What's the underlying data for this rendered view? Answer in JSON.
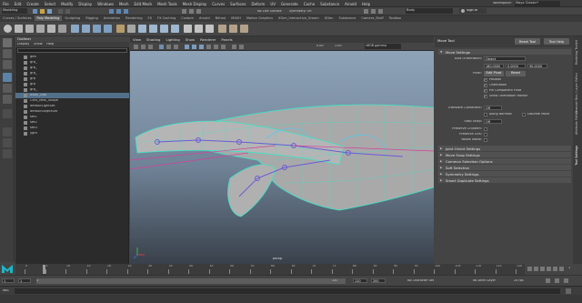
{
  "menubar": {
    "items": [
      "File",
      "Edit",
      "Create",
      "Select",
      "Modify",
      "Display",
      "Windows",
      "Mesh",
      "Edit Mesh",
      "Mesh Tools",
      "Mesh Display",
      "Curves",
      "Surfaces",
      "Deform",
      "UV",
      "Generate",
      "Cache",
      "Substance",
      "Arnold",
      "Help"
    ],
    "workspace_label": "Workspace:",
    "workspace_value": "Maya Classic*"
  },
  "status_line": {
    "mode_value": "Modeling",
    "no_live_surface": "No Live Surface",
    "symmetry_label": "Symmetry: Off",
    "search_value": "Body",
    "sign_in": "Sign In"
  },
  "shelf_tabs": [
    "Curves / Surfaces",
    "Poly Modeling",
    "Sculpting",
    "Rigging",
    "Animation",
    "Rendering",
    "FX",
    "FX Caching",
    "Custom",
    "Arnold",
    "Bifrost",
    "MASH",
    "Motion Graphics",
    "XGen_Interactive_Groom",
    "XGen",
    "Substance",
    "Camera_Stuff",
    "Toolbox"
  ],
  "shelf_active_tab": "Poly Modeling",
  "outliner": {
    "title": "Outliner",
    "menu": [
      "Display",
      "Show",
      "Help"
    ],
    "items": [
      {
        "label": "geo",
        "selected": false
      },
      {
        "label": "grp_",
        "selected": false
      },
      {
        "label": "grp_",
        "selected": false
      },
      {
        "label": "grp_",
        "selected": false
      },
      {
        "label": "grp",
        "selected": false
      },
      {
        "label": "grp",
        "selected": false
      },
      {
        "label": "grp_",
        "selected": false
      },
      {
        "label": "Body_Geo",
        "selected": true
      },
      {
        "label": "Ctrls_Rest_Shape",
        "selected": false
      },
      {
        "label": "defaultLightSet",
        "selected": false
      },
      {
        "label": "defaultObjectSet",
        "selected": false
      },
      {
        "label": "set1",
        "selected": false
      },
      {
        "label": "set2",
        "selected": false
      },
      {
        "label": "set3",
        "selected": false
      },
      {
        "label": "ygm",
        "selected": false
      }
    ]
  },
  "viewport": {
    "menu": [
      "View",
      "Shading",
      "Lighting",
      "Show",
      "Renderer",
      "Panels"
    ],
    "camera_label": "persp",
    "near_value": "0.00",
    "far_value": "1.00",
    "color_space": "sRGB gamma"
  },
  "tool_settings": {
    "title": "Move Tool",
    "reset_button": "Reset Tool",
    "help_button": "Tool Help",
    "sections": {
      "move_settings": "Move Settings",
      "joint_orient": "Joint Orient Settings",
      "move_snap": "Move Snap Settings",
      "common_selection": "Common Selection Options",
      "soft_selection": "Soft Selection",
      "symmetry": "Symmetry Settings",
      "smart_duplicate": "Smart Duplicate Settings"
    },
    "axis_orientation_label": "Axis Orientation:",
    "axis_orientation_value": "Object",
    "xyz": [
      "180.0000",
      "0.0000",
      "90.0000"
    ],
    "pivot_label": "Pivot:",
    "edit_pivot": "Edit Pivot",
    "reset": "Reset",
    "pivot_checks": [
      "Position",
      "Orientation",
      "Pin Component Pivot",
      "Show Orientation Handle"
    ],
    "translate_constraint_label": "Translate Constraint:",
    "translate_constraint_value": "Off",
    "along_normals": "Along Normals",
    "discrete_move": "Discrete Move",
    "step_snap_label": "Step Snap:",
    "step_snap_value": "Off",
    "preserve_children": "Preserve Children:",
    "preserve_uvs": "Preserve UVs:",
    "tweak_mode": "Tweak Mode:"
  },
  "side_tabs": [
    "Tool Settings",
    "Attribute Editor",
    "Channel Box / Layer Editor",
    "Modeling Toolkit"
  ],
  "timeline": {
    "ticks": [
      "0",
      "5",
      "10",
      "15",
      "20",
      "25",
      "30",
      "35",
      "40",
      "45",
      "50",
      "55",
      "60",
      "65",
      "70",
      "75",
      "80",
      "85",
      "90",
      "95",
      "100",
      "105",
      "110",
      "115",
      "120"
    ],
    "current_frame": "1"
  },
  "range_row": {
    "start": "1",
    "inner_start": "1",
    "inner_end": "120",
    "end": "120",
    "end2": "200",
    "character_set": "No Character Set",
    "anim_layer": "No Anim Layer",
    "fps": "24 fps"
  },
  "command_line": {
    "mel_label": "MEL"
  }
}
